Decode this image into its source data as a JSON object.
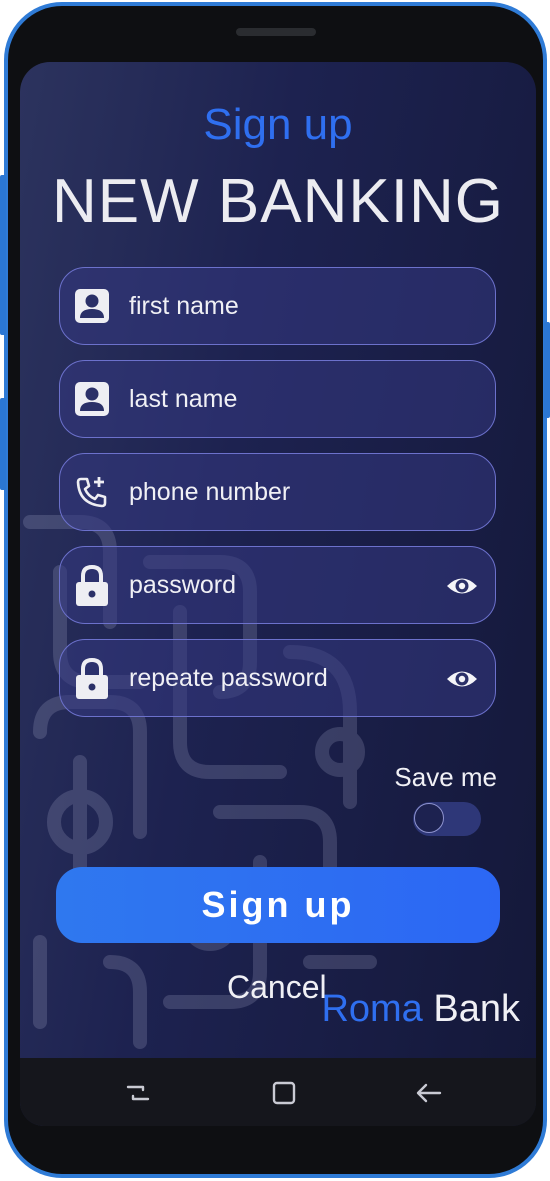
{
  "header": {
    "subtitle": "Sign up",
    "title": "NEW BANKING"
  },
  "form": {
    "fields": [
      {
        "label": "first name",
        "icon": "person-icon"
      },
      {
        "label": "last name",
        "icon": "person-icon"
      },
      {
        "label": "phone number",
        "icon": "phone-add-icon"
      },
      {
        "label": "password",
        "icon": "lock-icon",
        "toggle": "eye-icon"
      },
      {
        "label": "repeate password",
        "icon": "lock-icon",
        "toggle": "eye-icon"
      }
    ],
    "save_me_label": "Save me",
    "save_me_on": false
  },
  "actions": {
    "signup_label": "Sign up",
    "cancel_label": "Cancel"
  },
  "brand": {
    "part1": "Roma",
    "part2": "Bank"
  },
  "navbar": {
    "items": [
      "recents-icon",
      "home-icon",
      "back-icon"
    ]
  },
  "colors": {
    "accent": "#2f6ff0",
    "background": "#1d2250",
    "field_border": "#6c71cc"
  }
}
